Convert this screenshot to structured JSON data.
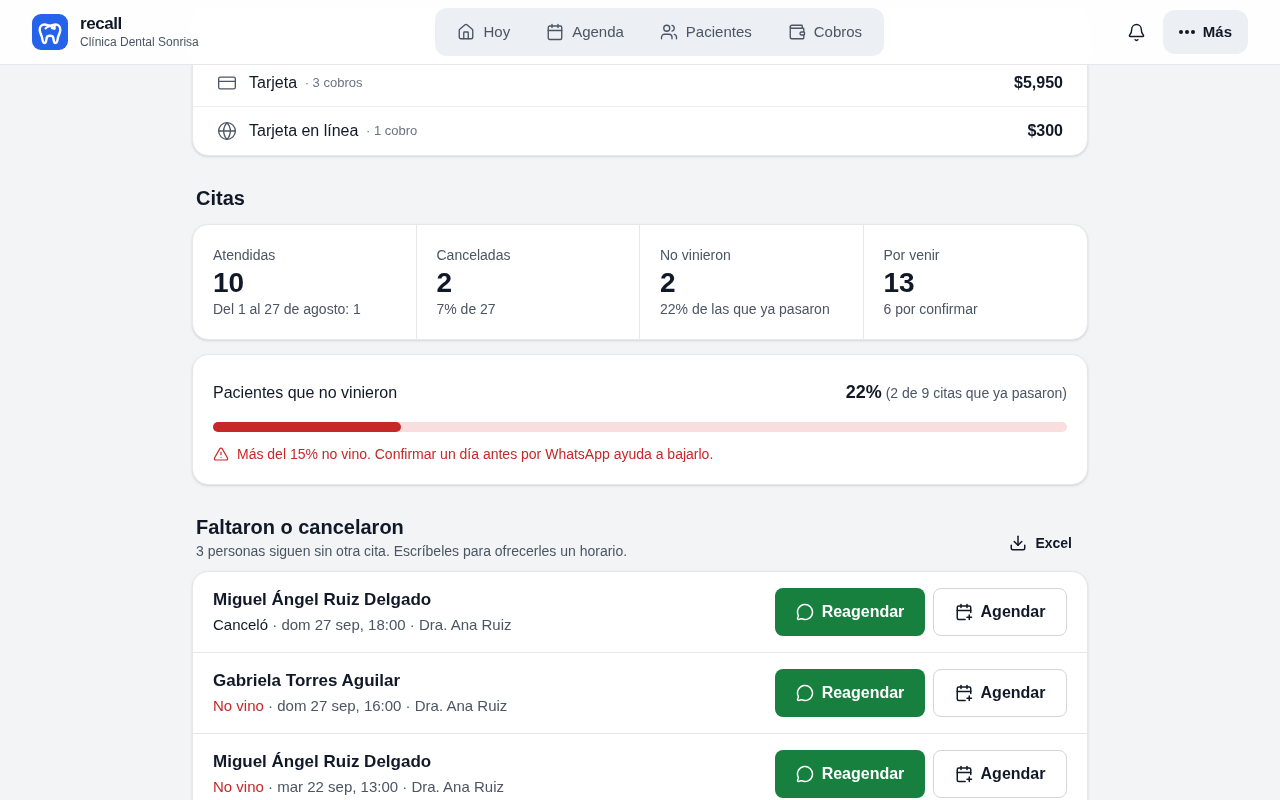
{
  "header": {
    "brand": "recall",
    "subtitle": "Clínica Dental Sonrisa",
    "nav": [
      {
        "label": "Hoy",
        "selected": false
      },
      {
        "label": "Agenda",
        "selected": false
      },
      {
        "label": "Pacientes",
        "selected": false
      },
      {
        "label": "Cobros",
        "selected": false
      }
    ],
    "more_button": "Más"
  },
  "payments": {
    "rows": [
      {
        "kind": "card",
        "method": "Tarjeta",
        "count": "· 3 cobros",
        "amount": "$5,950"
      },
      {
        "kind": "online",
        "method": "Tarjeta en línea",
        "count": "· 1 cobro",
        "amount": "$300"
      }
    ]
  },
  "citas": {
    "title": "Citas",
    "stats": [
      {
        "label": "Atendidas",
        "value": "10",
        "note": "Del 1 al 27 de agosto: 1"
      },
      {
        "label": "Canceladas",
        "value": "2",
        "note": "7% de 27"
      },
      {
        "label": "No vinieron",
        "value": "2",
        "note": "22% de las que ya pasaron"
      },
      {
        "label": "Por venir",
        "value": "13",
        "note": "6 por confirmar"
      }
    ]
  },
  "no_show": {
    "title": "Pacientes que no vinieron",
    "percent": "22%",
    "detail": "(2 de 9 citas que ya pasaron)",
    "level": 0.22,
    "warning": "Más del 15% no vino. Confirmar un día antes por WhatsApp ayuda a bajarlo."
  },
  "missed": {
    "title": "Faltaron o cancelaron",
    "subtitle": "3 personas siguen sin otra cita. Escríbeles para ofrecerles un horario.",
    "export_button": "Excel",
    "rows": [
      {
        "name": "Miguel Ángel Ruiz Delgado",
        "kind": "cancelled",
        "status": "Canceló",
        "details": "· dom 27 sep, 18:00 · Dra. Ana Ruiz",
        "primary_button": "Reagendar",
        "secondary_button": "Agendar"
      },
      {
        "name": "Gabriela Torres Aguilar",
        "kind": "no_show",
        "status": "No vino",
        "details": "· dom 27 sep, 16:00 · Dra. Ana Ruiz",
        "primary_button": "Reagendar",
        "secondary_button": "Agendar"
      },
      {
        "name": "Miguel Ángel Ruiz Delgado",
        "kind": "no_show",
        "status": "No vino",
        "details": "· mar 22 sep, 13:00 · Dra. Ana Ruiz",
        "primary_button": "Reagendar",
        "secondary_button": "Agendar"
      }
    ]
  }
}
